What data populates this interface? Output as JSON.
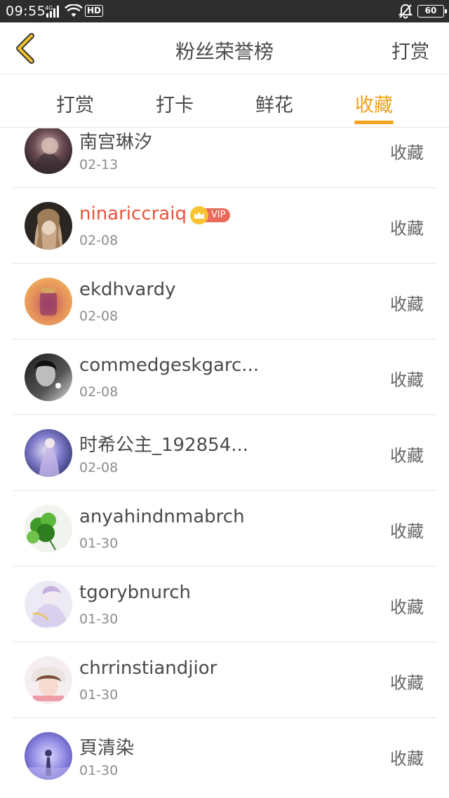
{
  "status_bar": {
    "time": "09:55",
    "network": "4G",
    "hd": "HD",
    "battery": "60"
  },
  "header": {
    "back_icon": "chevron-left-icon",
    "title": "粉丝荣誉榜",
    "right_action": "打赏"
  },
  "tabs": [
    {
      "label": "打赏",
      "active": false
    },
    {
      "label": "打卡",
      "active": false
    },
    {
      "label": "鲜花",
      "active": false
    },
    {
      "label": "收藏",
      "active": true
    }
  ],
  "colors": {
    "accent": "#f2a21a",
    "vip_name": "#e8543d",
    "text": "#4a4a4a",
    "secondary": "#8c8c8c"
  },
  "list": [
    {
      "name": "南宫琳汐",
      "date": "02-13",
      "action": "收藏",
      "vip": false
    },
    {
      "name": "ninariccraiq",
      "date": "02-08",
      "action": "收藏",
      "vip": true,
      "vip_label": "VIP"
    },
    {
      "name": "ekdhvardy",
      "date": "02-08",
      "action": "收藏",
      "vip": false
    },
    {
      "name": "commedgeskgarc...",
      "date": "02-08",
      "action": "收藏",
      "vip": false
    },
    {
      "name": "时希公主_192854...",
      "date": "02-08",
      "action": "收藏",
      "vip": false
    },
    {
      "name": "anyahindnmabrch",
      "date": "01-30",
      "action": "收藏",
      "vip": false
    },
    {
      "name": "tgorybnurch",
      "date": "01-30",
      "action": "收藏",
      "vip": false
    },
    {
      "name": "chrrinstiandjior",
      "date": "01-30",
      "action": "收藏",
      "vip": false
    },
    {
      "name": "頁清染",
      "date": "01-30",
      "action": "收藏",
      "vip": false
    }
  ]
}
